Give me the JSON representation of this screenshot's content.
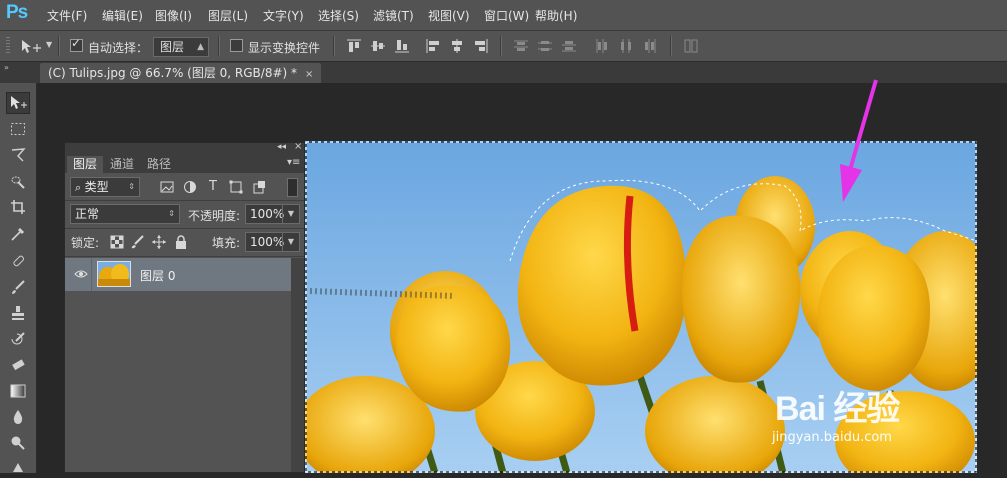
{
  "app": {
    "logo": "Ps"
  },
  "menu": [
    "文件(F)",
    "编辑(E)",
    "图像(I)",
    "图层(L)",
    "文字(Y)",
    "选择(S)",
    "滤镜(T)",
    "视图(V)",
    "窗口(W)",
    "帮助(H)"
  ],
  "options": {
    "auto_select_label": "自动选择：",
    "auto_select_checked": true,
    "auto_select_target": "图层",
    "show_transform_label": "显示变换控件",
    "show_transform_checked": false
  },
  "document_tab": {
    "title": "(C) Tulips.jpg @ 66.7% (图层 0, RGB/8#) *",
    "close": "×"
  },
  "layers_panel": {
    "tabs": [
      "图层",
      "通道",
      "路径"
    ],
    "filter_kind": "类型",
    "blend_mode": "正常",
    "opacity_label": "不透明度:",
    "opacity_value": "100%",
    "lock_label": "锁定:",
    "fill_label": "填充:",
    "fill_value": "100%",
    "layers": [
      {
        "name": "图层 0",
        "visible": true
      }
    ]
  },
  "watermark": {
    "logo": "Bai 经验",
    "url": "jingyan.baidu.com"
  },
  "colors": {
    "accent_arrow": "#e533e8",
    "menu_bg": "#535353",
    "layer_selected": "#6f7780"
  }
}
